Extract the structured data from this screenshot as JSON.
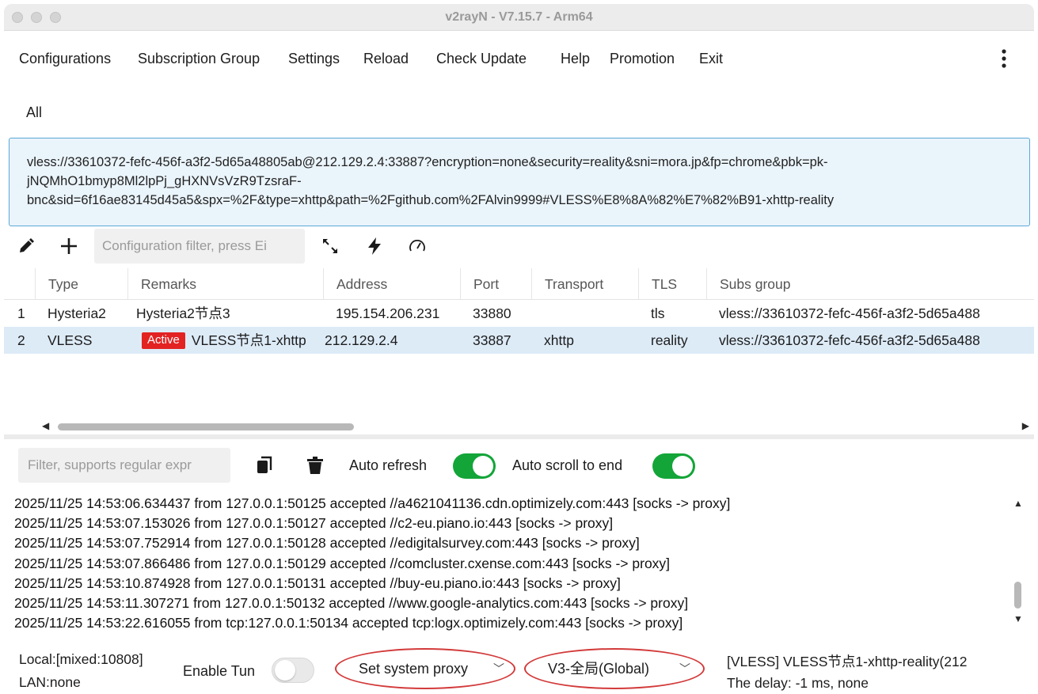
{
  "window": {
    "title": "v2rayN - V7.15.7 - Arm64"
  },
  "menu": {
    "items": [
      {
        "label": "Configurations"
      },
      {
        "label": "Subscription Group"
      },
      {
        "label": "Settings"
      },
      {
        "label": "Reload"
      },
      {
        "label": "Check Update"
      },
      {
        "label": "Help"
      },
      {
        "label": "Promotion"
      },
      {
        "label": "Exit"
      }
    ],
    "more_icon": "more-vertical-icon"
  },
  "groups": {
    "active_tab": "All"
  },
  "share_url": {
    "lines": [
      "vless://33610372-fefc-456f-a3f2-5d65a48805ab@212.129.2.4:33887?encryption=none&security=reality&sni=mora.jp&fp=chrome&pbk=pk-",
      "jNQMhO1bmyp8Ml2lpPj_gHXNVsVzR9TzsraF-",
      "bnc&sid=6f16ae83145d45a5&spx=%2F&type=xhttp&path=%2Fgithub.com%2FAlvin9999#VLESS%E8%8A%82%E7%82%B91-xhttp-reality"
    ]
  },
  "toolbar": {
    "edit_icon": "pencil-icon",
    "add_icon": "plus-icon",
    "filter_placeholder": "Configuration filter, press Ei",
    "expand_icon": "expand-arrows-icon",
    "bolt_icon": "lightning-icon",
    "speed_icon": "speedometer-icon"
  },
  "table": {
    "columns": [
      "Type",
      "Remarks",
      "Address",
      "Port",
      "Transport",
      "TLS",
      "Subs group"
    ],
    "rows": [
      {
        "index": "1",
        "type": "Hysteria2",
        "badge": "",
        "remarks": "Hysteria2节点3",
        "address": "195.154.206.231",
        "port": "33880",
        "transport": "",
        "tls": "tls",
        "subs": "vless://33610372-fefc-456f-a3f2-5d65a488"
      },
      {
        "index": "2",
        "type": "VLESS",
        "badge": "Active",
        "remarks": "VLESS节点1-xhttp",
        "address": "212.129.2.4",
        "port": "33887",
        "transport": "xhttp",
        "tls": "reality",
        "subs": "vless://33610372-fefc-456f-a3f2-5d65a488"
      }
    ]
  },
  "log_panel": {
    "filter_placeholder": "Filter, supports regular expr",
    "copy_icon": "copy-icon",
    "trash_icon": "trash-icon",
    "auto_refresh_label": "Auto refresh",
    "auto_refresh_on": true,
    "auto_scroll_label": "Auto scroll to end",
    "auto_scroll_on": true,
    "lines": [
      "2025/11/25 14:53:06.634437 from 127.0.0.1:50125 accepted //a4621041136.cdn.optimizely.com:443 [socks -> proxy]",
      "2025/11/25 14:53:07.153026 from 127.0.0.1:50127 accepted //c2-eu.piano.io:443 [socks -> proxy]",
      "2025/11/25 14:53:07.752914 from 127.0.0.1:50128 accepted //edigitalsurvey.com:443 [socks -> proxy]",
      "2025/11/25 14:53:07.866486 from 127.0.0.1:50129 accepted //comcluster.cxense.com:443 [socks -> proxy]",
      "2025/11/25 14:53:10.874928 from 127.0.0.1:50131 accepted //buy-eu.piano.io:443 [socks -> proxy]",
      "2025/11/25 14:53:11.307271 from 127.0.0.1:50132 accepted //www.google-analytics.com:443 [socks -> proxy]",
      "2025/11/25 14:53:22.616055 from tcp:127.0.0.1:50134 accepted tcp:logx.optimizely.com:443 [socks -> proxy]"
    ]
  },
  "status": {
    "local": "Local:[mixed:10808]",
    "lan": "LAN:none",
    "enable_tun_label": "Enable Tun",
    "enable_tun_on": false,
    "system_proxy_value": "Set system proxy",
    "routing_value": "V3-全局(Global)",
    "active_server": "[VLESS] VLESS节点1-xhttp-reality(212",
    "delay": "The delay: -1 ms, none"
  },
  "colors": {
    "accent_blue": "#5aa7d9",
    "toggle_on": "#13a538",
    "active_badge": "#e32222",
    "highlight_circle": "#d33a3a",
    "selected_row": "#ddebf7"
  }
}
